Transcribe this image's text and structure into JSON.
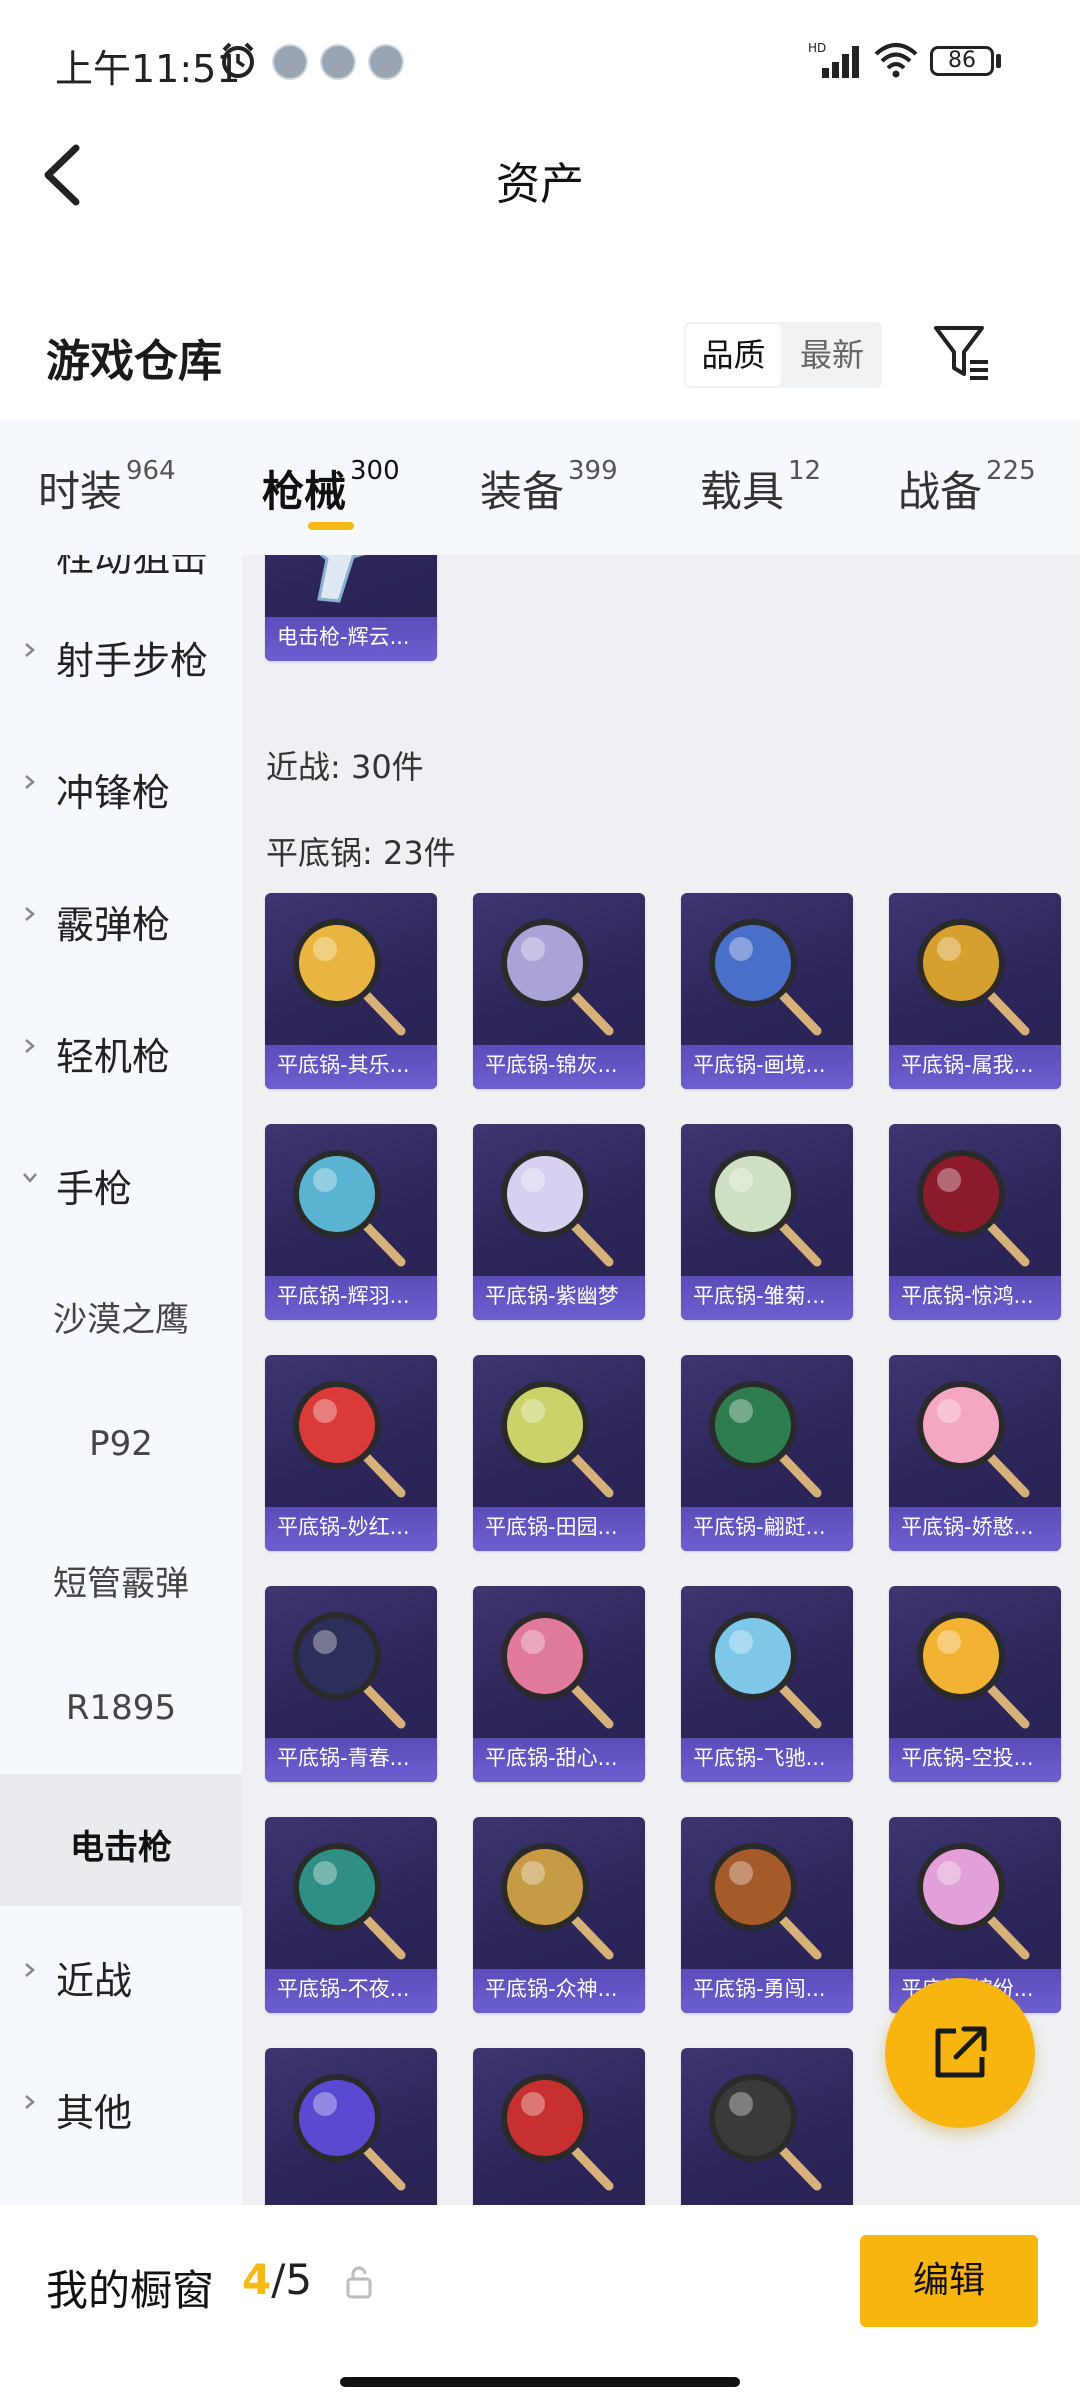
{
  "status_bar": {
    "time": "上午11:51",
    "battery": "86"
  },
  "header": {
    "title": "资产"
  },
  "warehouse": {
    "title": "游戏仓库",
    "sort_quality": "品质",
    "sort_latest": "最新"
  },
  "tabs": [
    {
      "label": "时装",
      "count": "964"
    },
    {
      "label": "枪械",
      "count": "300"
    },
    {
      "label": "装备",
      "count": "399"
    },
    {
      "label": "载具",
      "count": "12"
    },
    {
      "label": "战备",
      "count": "225"
    }
  ],
  "sidebar": {
    "partial_top": "栓动狙击",
    "items": [
      {
        "label": "射手步枪"
      },
      {
        "label": "冲锋枪"
      },
      {
        "label": "霰弹枪"
      },
      {
        "label": "轻机枪"
      },
      {
        "label": "手枪"
      }
    ],
    "subitems": [
      {
        "label": "沙漠之鹰"
      },
      {
        "label": "P92"
      },
      {
        "label": "短管霰弹"
      },
      {
        "label": "R1895"
      },
      {
        "label": "电击枪"
      }
    ],
    "after": [
      {
        "label": "近战"
      },
      {
        "label": "其他"
      }
    ]
  },
  "content": {
    "top_item": {
      "name": "电击枪-辉云..."
    },
    "melee_section": "近战: 30件",
    "pan_section": "平底锅: 23件",
    "pans": [
      {
        "name": "平底锅-其乐...",
        "color": "#e8b640"
      },
      {
        "name": "平底锅-锦灰...",
        "color": "#a9a3d6"
      },
      {
        "name": "平底锅-画境...",
        "color": "#4a6fc9"
      },
      {
        "name": "平底锅-属我...",
        "color": "#d6a02e"
      },
      {
        "name": "平底锅-辉羽...",
        "color": "#5ab3d0"
      },
      {
        "name": "平底锅-紫幽梦",
        "color": "#d8d0f0"
      },
      {
        "name": "平底锅-雏菊...",
        "color": "#cfe0c2"
      },
      {
        "name": "平底锅-惊鸿...",
        "color": "#8b1b2a"
      },
      {
        "name": "平底锅-妙红...",
        "color": "#d93a3a"
      },
      {
        "name": "平底锅-田园...",
        "color": "#c9d36a"
      },
      {
        "name": "平底锅-翩跹...",
        "color": "#2e7d4f"
      },
      {
        "name": "平底锅-娇憨...",
        "color": "#f4a7c3"
      },
      {
        "name": "平底锅-青春...",
        "color": "#2b2f5a"
      },
      {
        "name": "平底锅-甜心...",
        "color": "#e07a9a"
      },
      {
        "name": "平底锅-飞驰...",
        "color": "#7fc7e8"
      },
      {
        "name": "平底锅-空投...",
        "color": "#f2b233"
      },
      {
        "name": "平底锅-不夜...",
        "color": "#2f8f84"
      },
      {
        "name": "平底锅-众神...",
        "color": "#c79a46"
      },
      {
        "name": "平底锅-勇闯...",
        "color": "#a55a2a"
      },
      {
        "name": "平底锅-缤纷...",
        "color": "#e3a0d8"
      },
      {
        "name": "",
        "color": "#5a4ad0"
      },
      {
        "name": "",
        "color": "#c73030"
      },
      {
        "name": "",
        "color": "#3a3a3a"
      }
    ]
  },
  "bottom": {
    "label": "我的橱窗",
    "current": "4",
    "total": "/5",
    "edit": "编辑"
  }
}
